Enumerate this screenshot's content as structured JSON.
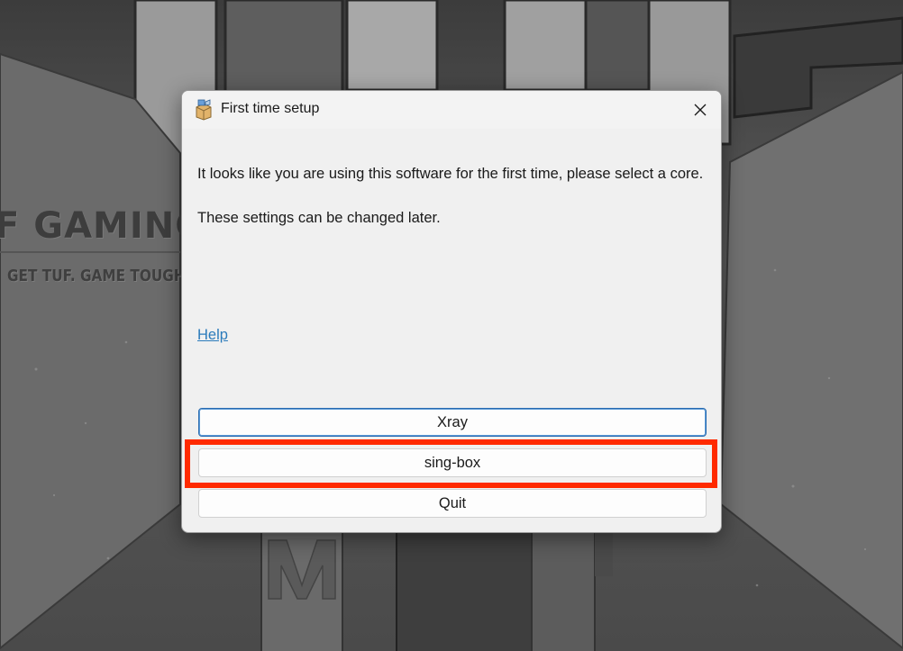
{
  "desktop": {
    "brand_main": "F GAMING",
    "brand_sub": "GET TUF. GAME TOUGH"
  },
  "dialog": {
    "title": "First time setup",
    "app_icon": "package-icon",
    "close_icon": "close-icon",
    "message": "It looks like you are using this software for the first time, please select a core.",
    "note": "These settings can be changed later.",
    "help_link": "Help",
    "buttons": {
      "xray": "Xray",
      "singbox": "sing-box",
      "quit": "Quit"
    }
  },
  "colors": {
    "dialog_bg": "#f0f0f0",
    "link": "#2b7bbb",
    "primary_border": "#2b6cb0",
    "highlight": "#ff2a00"
  }
}
